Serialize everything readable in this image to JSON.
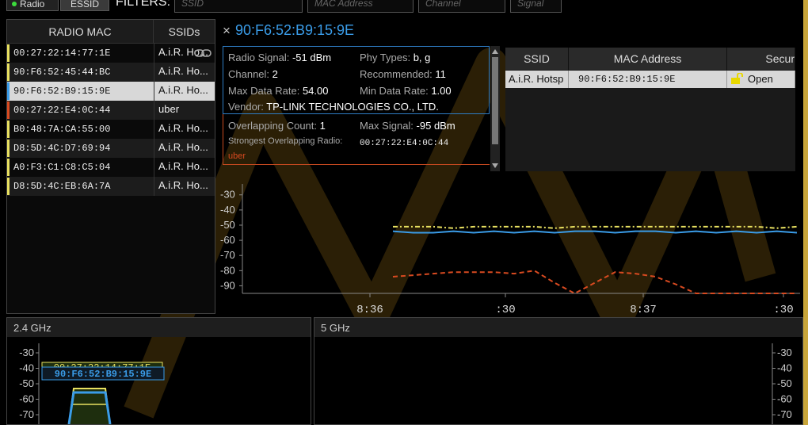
{
  "topbar": {
    "radio_label": "Radio",
    "essid_label": "ESSID",
    "filters_label": "FILTERS:",
    "filter_ssid_placeholder": "SSID",
    "filter_mac_placeholder": "MAC Address",
    "filter_channel_placeholder": "Channel",
    "filter_signal_placeholder": "Signal"
  },
  "radio_table": {
    "col_mac": "RADIO MAC",
    "col_ssids": "SSIDs",
    "rows": [
      {
        "mac": "00:27:22:14:77:1E",
        "ssid": "A.i.R. Ho...",
        "color": "#e8e060",
        "linked": true
      },
      {
        "mac": "90:F6:52:45:44:BC",
        "ssid": "A.i.R. Ho...",
        "color": "#e8e060"
      },
      {
        "mac": "90:F6:52:B9:15:9E",
        "ssid": "A.i.R. Ho...",
        "color": "#3a9ce8",
        "selected": true
      },
      {
        "mac": "00:27:22:E4:0C:44",
        "ssid": "uber",
        "color": "#d84a20"
      },
      {
        "mac": "B0:48:7A:CA:55:00",
        "ssid": "A.i.R. Ho...",
        "color": "#e8e060"
      },
      {
        "mac": "D8:5D:4C:D7:69:94",
        "ssid": "A.i.R. Ho...",
        "color": "#e8e060"
      },
      {
        "mac": "A0:F3:C1:C8:C5:04",
        "ssid": "A.i.R. Ho...",
        "color": "#e8e060"
      },
      {
        "mac": "D8:5D:4C:EB:6A:7A",
        "ssid": "A.i.R. Ho...",
        "color": "#e8e060"
      }
    ]
  },
  "detail": {
    "close_glyph": "×",
    "title": "90:F6:52:B9:15:9E",
    "radio_signal_label": "Radio Signal:",
    "radio_signal_value": "-51 dBm",
    "phy_types_label": "Phy Types:",
    "phy_types_value": "b, g",
    "channel_label": "Channel:",
    "channel_value": "2",
    "recommended_label": "Recommended:",
    "recommended_value": "11",
    "max_rate_label": "Max Data Rate:",
    "max_rate_value": "54.00",
    "min_rate_label": "Min Data Rate:",
    "min_rate_value": "1.00",
    "vendor_label": "Vendor:",
    "vendor_value": "TP-LINK TECHNOLOGIES CO., LTD.",
    "overlap_count_label": "Overlapping Count:",
    "overlap_count_value": "1",
    "max_signal_label": "Max Signal:",
    "max_signal_value": "-95 dBm",
    "strongest_label": "Strongest Overlapping Radio:",
    "strongest_mac": "00:27:22:E4:0C:44",
    "strongest_ssid": "uber"
  },
  "ssid_table": {
    "col_ssid": "SSID",
    "col_mac": "MAC Address",
    "col_security": "Secur",
    "row": {
      "ssid": "A.i.R. Hotsp",
      "mac": "90:F6:52:B9:15:9E",
      "security": "Open"
    }
  },
  "chart_data": {
    "type": "line",
    "y_ticks": [
      "-30",
      "-40",
      "-50",
      "-60",
      "-70",
      "-80",
      "-90"
    ],
    "x_ticks": [
      "8:36",
      ":30",
      "8:37",
      ":30"
    ],
    "ylim": [
      -95,
      -27
    ],
    "series": [
      {
        "color": "#e8e060",
        "style": "dash-dot",
        "values": [
          -51,
          -51,
          -51,
          -52,
          -51,
          -51,
          -51,
          -51,
          -52,
          -51,
          -51,
          -51,
          -51,
          -51,
          -51,
          -51,
          -51,
          -51,
          -51,
          -52,
          -51
        ]
      },
      {
        "color": "#3a9ce8",
        "style": "solid",
        "values": [
          -54,
          -55,
          -55,
          -54,
          -55,
          -54,
          -55,
          -54,
          -55,
          -54,
          -54,
          -55,
          -54,
          -54,
          -55,
          -54,
          -55,
          -54,
          -55,
          -54,
          -55
        ]
      },
      {
        "color": "#d84a20",
        "style": "dashed",
        "values": [
          -84,
          -83,
          -82,
          -81,
          -81,
          -81,
          -82,
          -80,
          -88,
          -95,
          -88,
          -81,
          -82,
          -84,
          -89,
          -95,
          -95,
          -95,
          -95,
          -95,
          -95
        ]
      }
    ]
  },
  "band24": {
    "title": "2.4 GHz",
    "y_ticks": [
      "-30",
      "-40",
      "-50",
      "-60",
      "-70"
    ],
    "label_back": "00:27:22:14:77:1E",
    "label_front": "90:F6:52:B9:15:9E"
  },
  "band5": {
    "title": "5 GHz",
    "y_ticks": [
      "-30",
      "-40",
      "-50",
      "-60",
      "-70"
    ]
  },
  "colors": {
    "accent_blue": "#3a9ce8",
    "accent_yellow": "#e8e060",
    "accent_red": "#d84a20",
    "chart_green": "#3cdc3c"
  }
}
